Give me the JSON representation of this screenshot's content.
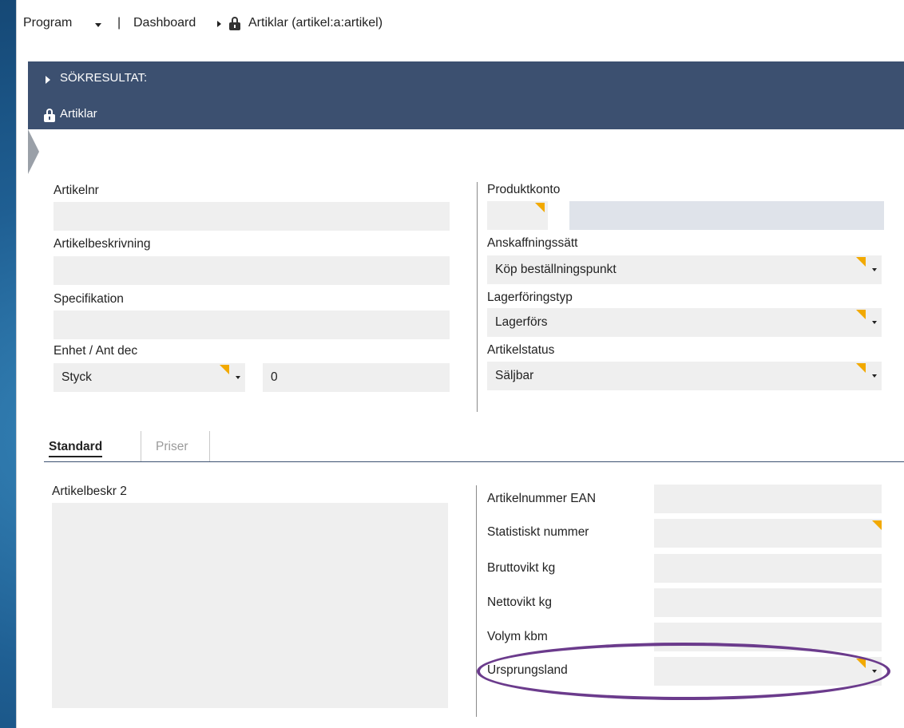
{
  "breadcrumb": {
    "program": "Program",
    "separator": "|",
    "dashboard": "Dashboard",
    "current": "Artiklar (artikel:a:artikel)"
  },
  "header": {
    "search_results": "SÖKRESULTAT:",
    "module": "Artiklar"
  },
  "form": {
    "artikelnr": {
      "label": "Artikelnr",
      "value": ""
    },
    "artikelbeskrivning": {
      "label": "Artikelbeskrivning",
      "value": ""
    },
    "specifikation": {
      "label": "Specifikation",
      "value": ""
    },
    "enhet": {
      "label": "Enhet / Ant dec",
      "unit": "Styck",
      "decimals": "0"
    },
    "produktkonto": {
      "label": "Produktkonto"
    },
    "anskaffningssatt": {
      "label": "Anskaffningssätt",
      "value": "Köp beställningspunkt"
    },
    "lagerforingstyp": {
      "label": "Lagerföringstyp",
      "value": "Lagerförs"
    },
    "artikelstatus": {
      "label": "Artikelstatus",
      "value": "Säljbar"
    }
  },
  "tabs": [
    {
      "label": "Standard",
      "active": true
    },
    {
      "label": "Priser",
      "active": false
    }
  ],
  "standard": {
    "artikelbeskr2": "Artikelbeskr 2",
    "ean": "Artikelnummer EAN",
    "statistiskt": "Statistiskt nummer",
    "brutto": "Bruttovikt kg",
    "netto": "Nettovikt kg",
    "volym": "Volym kbm",
    "ursprungsland": "Ursprungsland"
  },
  "colors": {
    "header_bg": "#3c5070",
    "required_flag": "#f2a900",
    "highlight_oval": "#6b3b8c"
  }
}
